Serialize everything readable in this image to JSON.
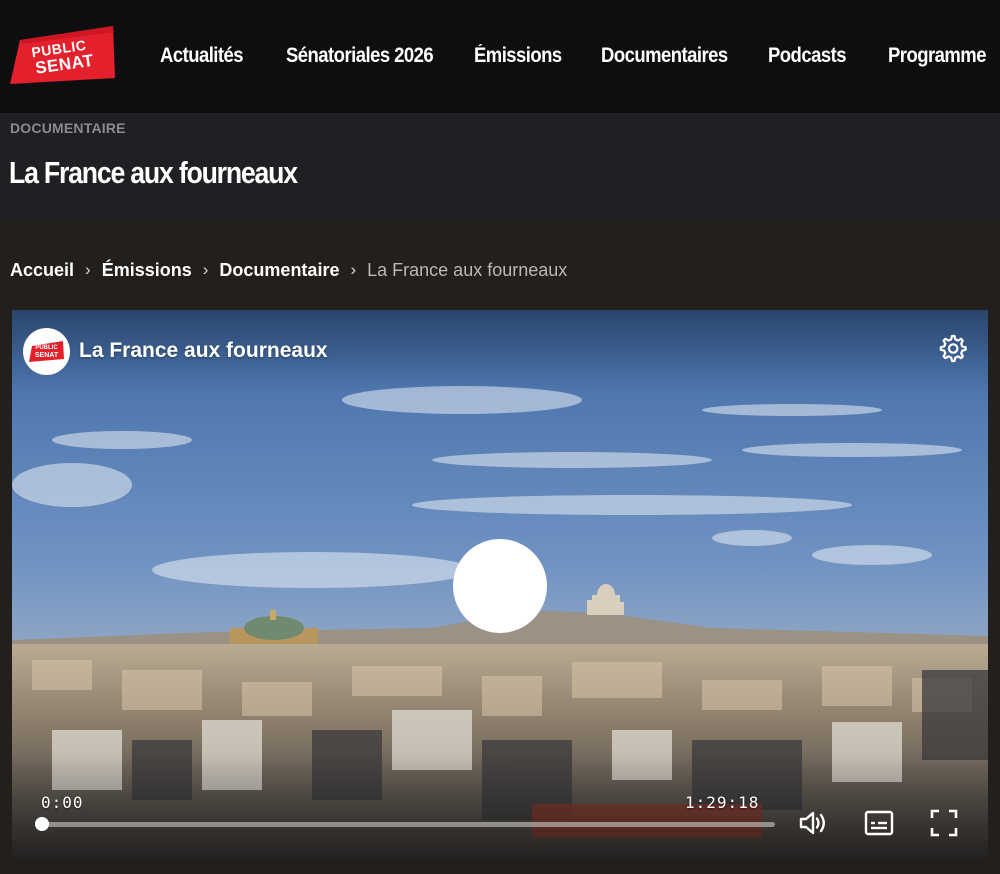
{
  "header": {
    "logo": {
      "line1": "PUBLIC",
      "line2": "SENAT"
    },
    "nav": [
      {
        "label": "Actualités"
      },
      {
        "label": "Sénatoriales 2026"
      },
      {
        "label": "Émissions"
      },
      {
        "label": "Documentaires"
      },
      {
        "label": "Podcasts"
      },
      {
        "label": "Programme"
      }
    ]
  },
  "page": {
    "category": "DOCUMENTAIRE",
    "title": "La France aux fourneaux"
  },
  "breadcrumb": {
    "items": [
      "Accueil",
      "Émissions",
      "Documentaire"
    ],
    "current": "La France aux fourneaux",
    "separator": "›"
  },
  "player": {
    "logo": {
      "line1": "PUBLIC",
      "line2": "SENAT"
    },
    "title": "La France aux fourneaux",
    "current_time": "0:00",
    "total_time": "1:29:18",
    "progress_fraction": 0,
    "icons": {
      "settings": "gear-icon",
      "play": "play-icon",
      "volume": "volume-icon",
      "subtitles": "subtitles-icon",
      "fullscreen": "fullscreen-icon"
    }
  },
  "colors": {
    "brand_red": "#e3202b",
    "nav_bg": "#0e0e10",
    "title_band_bg": "#1f2023",
    "category_text": "#8a8b8f",
    "crumb_current": "#b9b9b9"
  }
}
